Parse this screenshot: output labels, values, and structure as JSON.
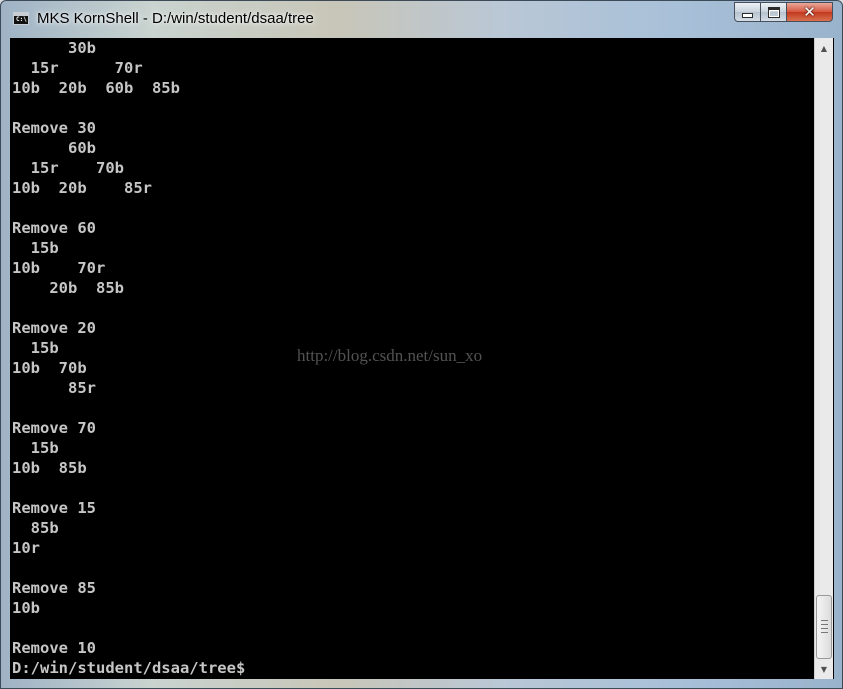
{
  "window": {
    "title": "MKS KornShell - D:/win/student/dsaa/tree",
    "icon_label": "C:\\"
  },
  "console": {
    "lines": [
      "      30b",
      "  15r      70r",
      "10b  20b  60b  85b",
      "",
      "Remove 30",
      "      60b",
      "  15r    70b",
      "10b  20b    85r",
      "",
      "Remove 60",
      "  15b",
      "10b    70r",
      "    20b  85b",
      "",
      "Remove 20",
      "  15b",
      "10b  70b",
      "      85r",
      "",
      "Remove 70",
      "  15b",
      "10b  85b",
      "",
      "Remove 15",
      "  85b",
      "10r",
      "",
      "Remove 85",
      "10b",
      "",
      "Remove 10",
      "D:/win/student/dsaa/tree$"
    ]
  },
  "watermark": "http://blog.csdn.net/sun_xo",
  "scrollbar": {
    "position_fraction": 1.0
  },
  "icons": {
    "app": "console-icon",
    "minimize": "minimize-icon",
    "maximize": "maximize-icon",
    "close": "close-icon",
    "scroll_up": "up-arrow-icon",
    "scroll_down": "down-arrow-icon"
  },
  "colors": {
    "console_bg": "#000000",
    "console_fg": "#c6c6c6",
    "close_button": "#c3381e"
  }
}
